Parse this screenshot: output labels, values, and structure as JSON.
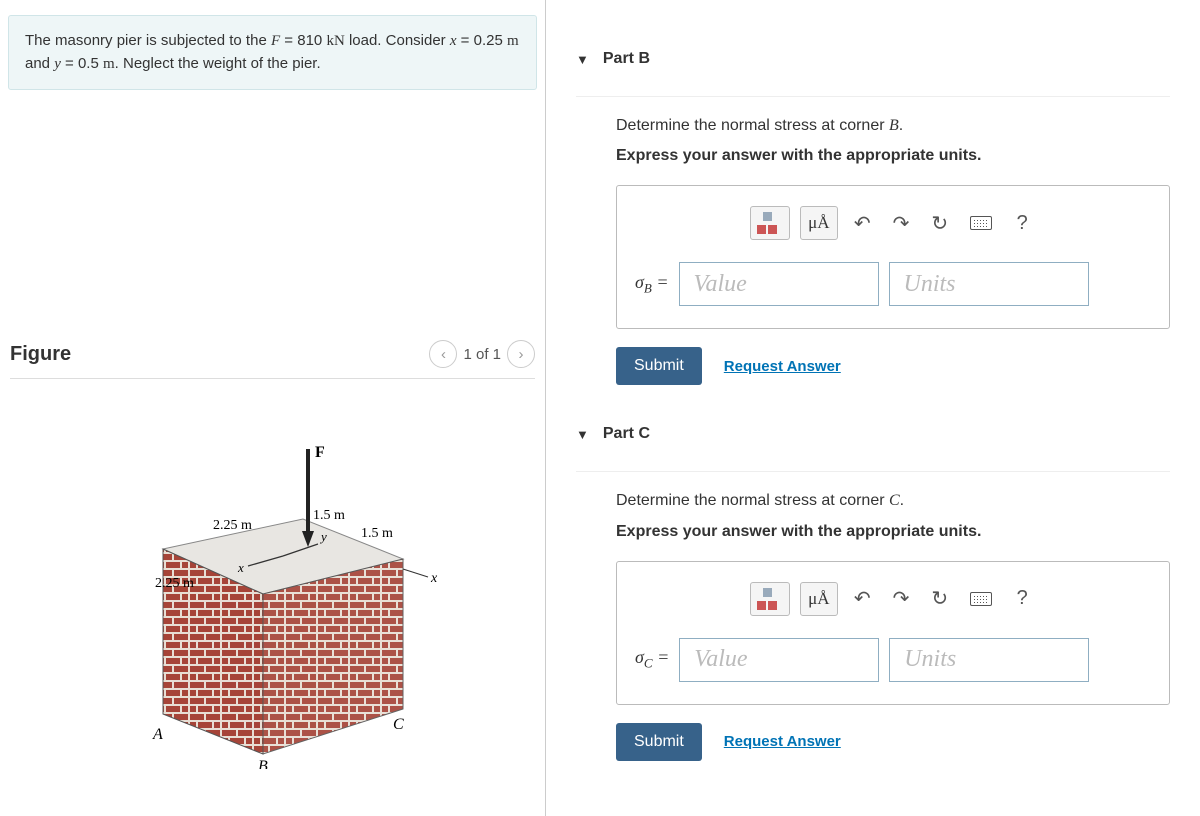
{
  "problem": {
    "text_pre": "The masonry pier is subjected to the ",
    "F_var": "F",
    "F_eq": " = 810 ",
    "F_unit": "kN",
    "F_post": " load. Consider ",
    "x_var": "x",
    "x_eq": " = 0.25 ",
    "x_unit": "m",
    "and": " and ",
    "y_var": "y",
    "y_eq": " = 0.5 ",
    "y_unit": "m",
    "tail": ". Neglect the weight of the pier."
  },
  "figure": {
    "title": "Figure",
    "nav_label": "1 of 1",
    "dims": {
      "d1": "2.25 m",
      "d2": "2.25 m",
      "d3": "1.5 m",
      "d4": "1.5 m"
    },
    "labels": {
      "F": "F",
      "A": "A",
      "B": "B",
      "C": "C",
      "x": "x",
      "y": "y"
    }
  },
  "partB": {
    "title": "Part B",
    "prompt_pre": "Determine the normal stress at corner ",
    "prompt_var": "B",
    "prompt_post": ".",
    "instruction": "Express your answer with the appropriate units.",
    "sigma_label": "σ",
    "sigma_sub": "B",
    "equals": " =",
    "value_placeholder": "Value",
    "units_placeholder": "Units",
    "units_btn": "μÅ",
    "submit": "Submit",
    "request": "Request Answer",
    "help": "?"
  },
  "partC": {
    "title": "Part C",
    "prompt_pre": "Determine the normal stress at corner ",
    "prompt_var": "C",
    "prompt_post": ".",
    "instruction": "Express your answer with the appropriate units.",
    "sigma_label": "σ",
    "sigma_sub": "C",
    "equals": " =",
    "value_placeholder": "Value",
    "units_placeholder": "Units",
    "units_btn": "μÅ",
    "submit": "Submit",
    "request": "Request Answer",
    "help": "?"
  }
}
